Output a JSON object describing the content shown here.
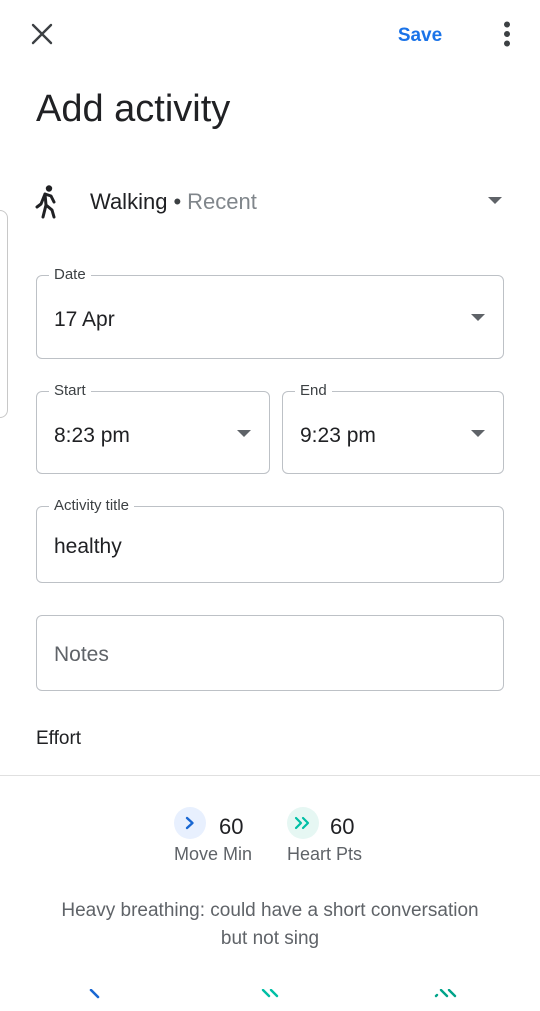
{
  "toolbar": {
    "close_icon": "close-icon",
    "save_label": "Save",
    "more_icon": "more-vert-icon"
  },
  "page": {
    "title": "Add activity"
  },
  "activity": {
    "icon": "walking-icon",
    "name": "Walking",
    "separator": "•",
    "sub": "Recent"
  },
  "date": {
    "label": "Date",
    "value": "17 Apr"
  },
  "start": {
    "label": "Start",
    "value": "8:23 pm"
  },
  "end": {
    "label": "End",
    "value": "9:23 pm"
  },
  "activity_title": {
    "label": "Activity title",
    "value": "healthy"
  },
  "notes": {
    "placeholder": "Notes"
  },
  "effort": {
    "label": "Effort",
    "move_min_value": "60",
    "move_min_label": "Move Min",
    "heart_pts_value": "60",
    "heart_pts_label": "Heart Pts",
    "description": "Heavy breathing: could have a short conversation but not sing"
  },
  "colors": {
    "accent": "#1a73e8",
    "move_blue": "#1967d2",
    "heart_teal": "#00bfa5"
  }
}
